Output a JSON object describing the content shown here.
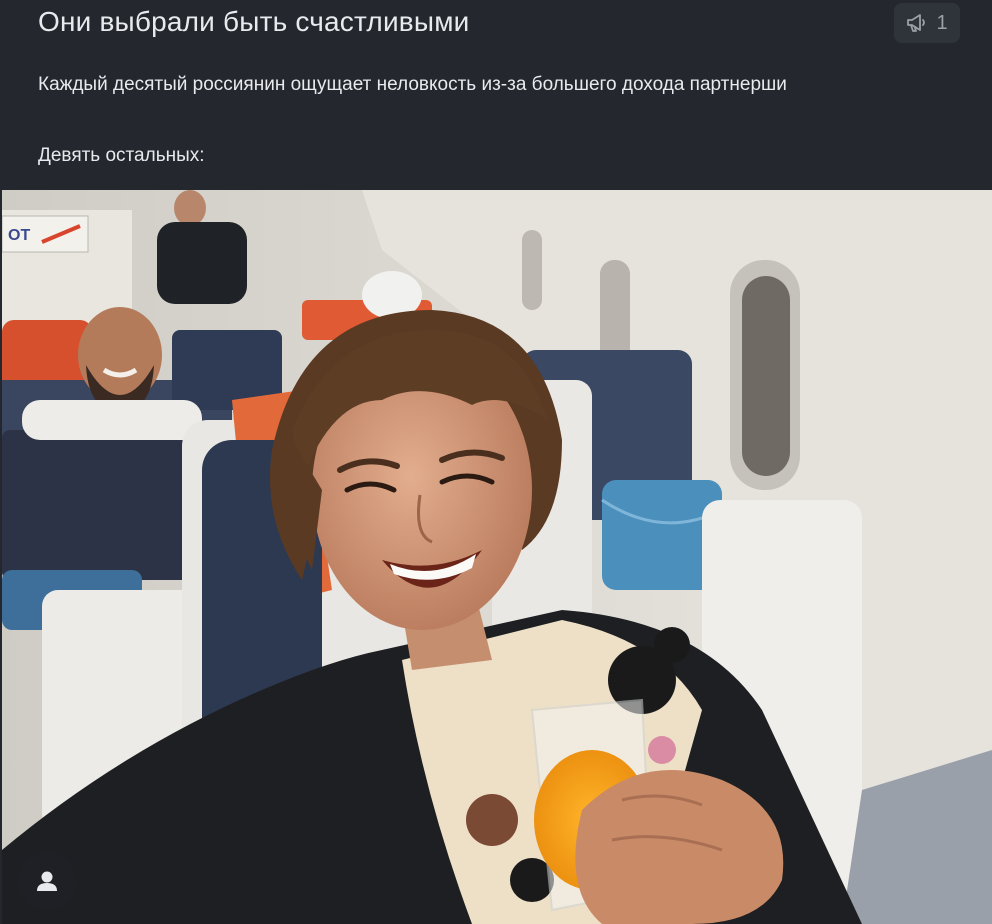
{
  "post": {
    "title": "Они выбрали быть счастливыми",
    "repost_count": "1",
    "lines": [
      "Каждый десятый россиянин ощущает неловкость из-за большего дохода партнерши",
      "Девять остальных:"
    ]
  },
  "icons": {
    "repost": "megaphone-icon",
    "author": "user-icon"
  },
  "colors": {
    "background": "#24282e",
    "text": "#e8eaed",
    "muted": "#9aa0a6"
  }
}
